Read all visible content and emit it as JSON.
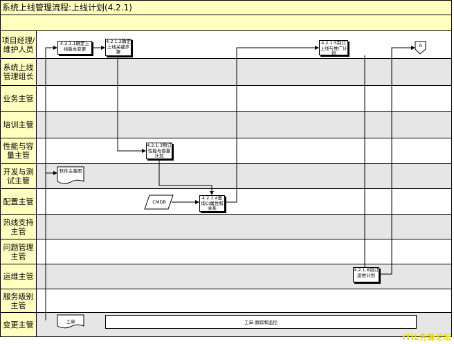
{
  "title": "系统上线管理流程:上线计划(4.2.1)",
  "lanes": [
    "项目经理/维护人员",
    "系统上线管理组长",
    "业务主管",
    "培训主管",
    "性能与容量主管",
    "开发与测试主管",
    "配置主管",
    "热线支持主管",
    "问题管理主管",
    "运维主管",
    "服务级别主管",
    "变更主管"
  ],
  "steps": {
    "s1": "4.2.1.1确定上线版本变更",
    "s2": "4.2.1.2确定上线关键步骤",
    "s3": "4.2.1.3制订性能与容量计划",
    "s4": "4.2.1.4查询CI属性和关系",
    "s5": "4.2.1.5制订上线与推广计划",
    "s6": "4.2.1.6制订运维计划"
  },
  "docs": {
    "software_baseline": "软件主基图",
    "cmdb": "CMDB",
    "workorder": "工单",
    "tracking": "工单-跟踪和监控"
  },
  "connector": "A",
  "watermark": "ITIL先锋论坛"
}
